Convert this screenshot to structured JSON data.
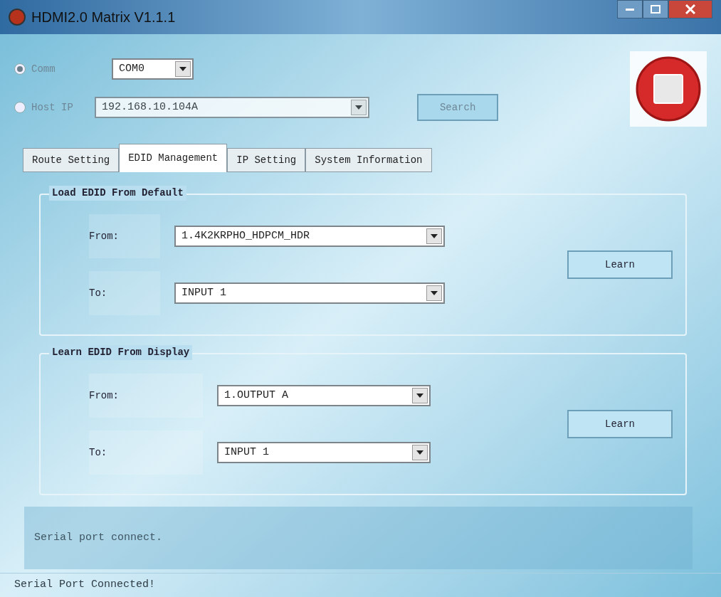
{
  "window": {
    "title": "HDMI2.0 Matrix V1.1.1"
  },
  "connection": {
    "options": [
      {
        "label": "Comm",
        "selected": true,
        "value": "COM0"
      },
      {
        "label": "Host IP",
        "selected": false,
        "value": "192.168.10.104A"
      }
    ],
    "search_button": "Search"
  },
  "tabs": [
    {
      "label": "Route Setting",
      "selected": false
    },
    {
      "label": "EDID Management",
      "selected": true
    },
    {
      "label": "IP Setting",
      "selected": false
    },
    {
      "label": "System Information",
      "selected": false
    }
  ],
  "groups": [
    {
      "title": "Load EDID From Default",
      "rows": [
        {
          "label": "From:",
          "value": "1.4K2KRPHO_HDPCM_HDR"
        },
        {
          "label": "To:",
          "value": "INPUT 1"
        }
      ],
      "button": "Learn"
    },
    {
      "title": "Learn EDID From Display",
      "rows": [
        {
          "label": "From:",
          "value": "1.OUTPUT A"
        },
        {
          "label": "To:",
          "value": "INPUT 1"
        }
      ],
      "button": "Learn"
    }
  ],
  "message": "Serial port connect.",
  "status_bar": "Serial Port Connected!"
}
